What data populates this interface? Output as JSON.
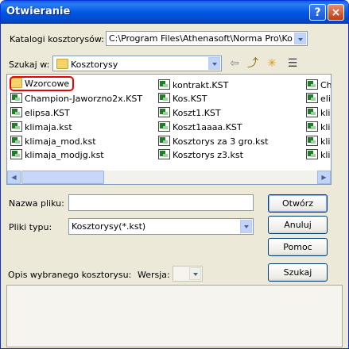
{
  "window": {
    "title": "Otwieranie",
    "help_glyph": "?",
    "close_glyph": "×"
  },
  "catalog": {
    "label": "Katalogi kosztorysów:",
    "value": "C:\\Program Files\\Athenasoft\\Norma Pro\\Kosztor"
  },
  "lookin": {
    "label": "Szukaj w:",
    "value": "Kosztorysy"
  },
  "toolbar": {
    "back_glyph": "⇦",
    "up_glyph": "⤴",
    "newfolder_glyph": "✳",
    "view_glyph": "☰"
  },
  "files": {
    "col1": [
      "Wzorcowe",
      "Champion-Jaworzno2x.KST",
      "elipsa.KST",
      "klimaja.kst",
      "klimaja_mod.kst",
      "klimaja_modjg.kst"
    ],
    "col2": [
      "kontrakt.KST",
      "Kos.KST",
      "Koszt1.KST",
      "Koszt1aaaa.KST",
      "Kosztorys za 3 gro.kst",
      "Kosztorys z3.kst"
    ],
    "col3": [
      "Cha",
      "elipa",
      "klim",
      "klim",
      "klim",
      "klim"
    ]
  },
  "filename": {
    "label": "Nazwa pliku:",
    "value": ""
  },
  "filetype": {
    "label": "Pliki typu:",
    "value": "Kosztorysy(*.kst)"
  },
  "buttons": {
    "open": "Otwórz",
    "cancel": "Anuluj",
    "help": "Pomoc",
    "search": "Szukaj"
  },
  "description": {
    "label": "Opis wybranego kosztorysu:",
    "version_label": "Wersja:",
    "version_value": ""
  },
  "scroll": {
    "left_glyph": "◀",
    "right_glyph": "▶"
  }
}
